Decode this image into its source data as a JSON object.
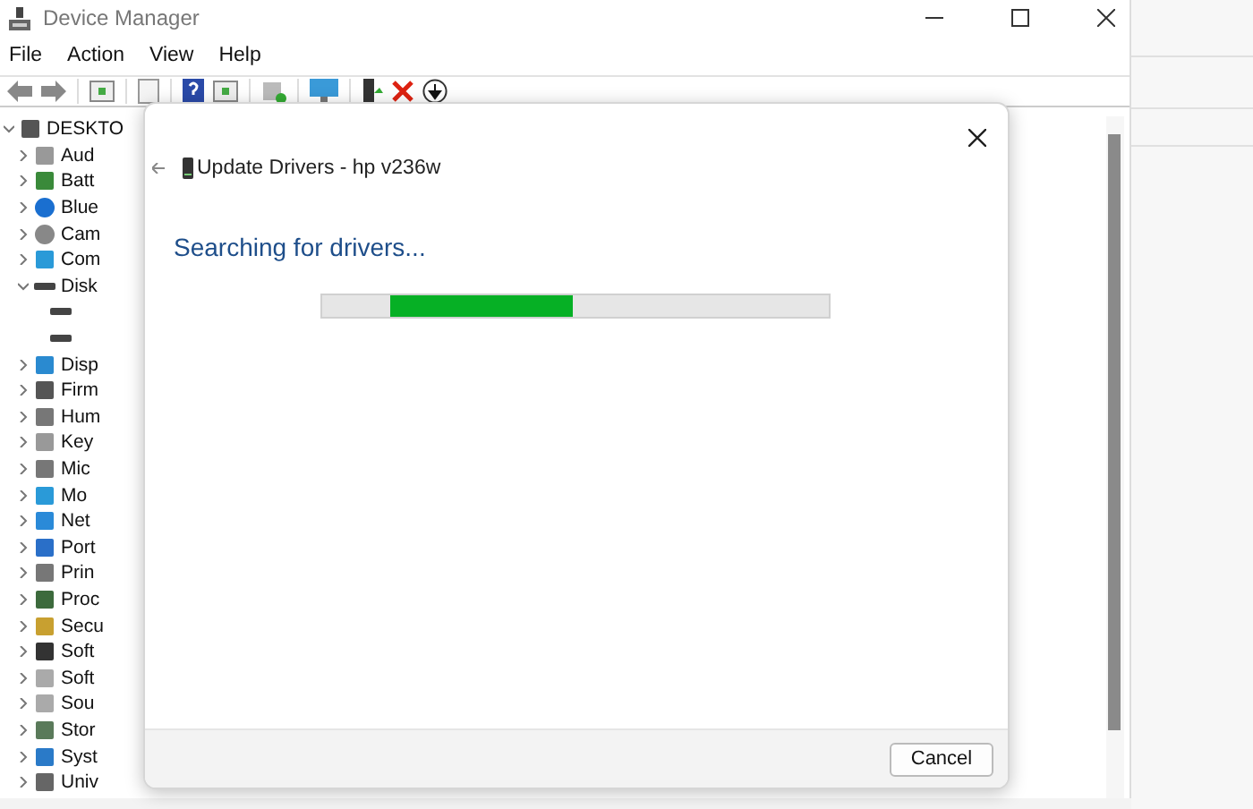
{
  "window": {
    "title": "Device Manager"
  },
  "menu": [
    "File",
    "Action",
    "View",
    "Help"
  ],
  "tree": {
    "label": "DESKTO",
    "kind": "computer",
    "expanded": true,
    "children": [
      {
        "label": "Aud",
        "kind": "audio",
        "expanded": false
      },
      {
        "label": "Batt",
        "kind": "battery",
        "expanded": false
      },
      {
        "label": "Blue",
        "kind": "bluetooth",
        "expanded": false
      },
      {
        "label": "Cam",
        "kind": "camera",
        "expanded": false
      },
      {
        "label": "Com",
        "kind": "monitor",
        "expanded": false
      },
      {
        "label": "Disk",
        "kind": "drive",
        "expanded": true,
        "children": [
          {
            "kind": "drive"
          },
          {
            "kind": "drive"
          }
        ]
      },
      {
        "label": "Disp",
        "kind": "display",
        "expanded": false
      },
      {
        "label": "Firm",
        "kind": "firmware",
        "expanded": false
      },
      {
        "label": "Hum",
        "kind": "hid",
        "expanded": false
      },
      {
        "label": "Key",
        "kind": "keyboard",
        "expanded": false
      },
      {
        "label": "Mic",
        "kind": "mouse",
        "expanded": false
      },
      {
        "label": "Mo",
        "kind": "monitor",
        "expanded": false
      },
      {
        "label": "Net",
        "kind": "network",
        "expanded": false
      },
      {
        "label": "Port",
        "kind": "port",
        "expanded": false
      },
      {
        "label": "Prin",
        "kind": "printer",
        "expanded": false
      },
      {
        "label": "Proc",
        "kind": "processor",
        "expanded": false
      },
      {
        "label": "Secu",
        "kind": "security",
        "expanded": false
      },
      {
        "label": "Soft",
        "kind": "software",
        "expanded": false
      },
      {
        "label": "Soft",
        "kind": "softdevice",
        "expanded": false
      },
      {
        "label": "Sou",
        "kind": "sound",
        "expanded": false
      },
      {
        "label": "Stor",
        "kind": "storage",
        "expanded": false
      },
      {
        "label": "Syst",
        "kind": "system",
        "expanded": false
      },
      {
        "label": "Univ",
        "kind": "usb",
        "expanded": false
      }
    ]
  },
  "dialog": {
    "title": "Update Drivers - hp v236w",
    "heading": "Searching for drivers...",
    "progress": {
      "level": 0.36
    },
    "button": "Cancel"
  }
}
